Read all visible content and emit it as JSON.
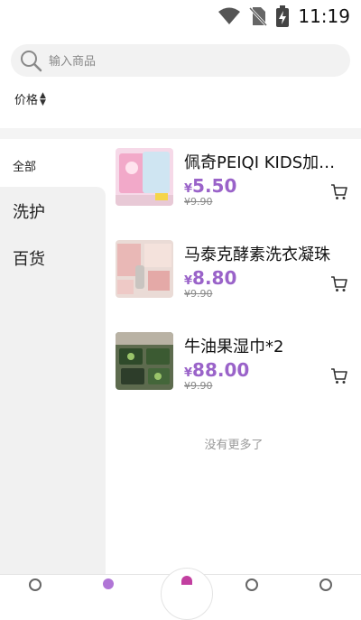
{
  "status_bar": {
    "time": "11:19"
  },
  "search": {
    "placeholder": "输入商品",
    "value": ""
  },
  "sort": {
    "label": "价格",
    "icon": "sort-updown-icon"
  },
  "sidebar": {
    "items": [
      {
        "label": "全部",
        "selected": true
      },
      {
        "label": "洗护",
        "selected": false
      },
      {
        "label": "百货",
        "selected": false
      }
    ]
  },
  "products": [
    {
      "name": "佩奇PEIQI KIDS加厚婴儿手口湿巾",
      "currency": "¥",
      "price": "5.50",
      "original_price": "¥9.90"
    },
    {
      "name": "马泰克酵素洗衣凝珠",
      "currency": "¥",
      "price": "8.80",
      "original_price": "¥9.90"
    },
    {
      "name": "牛油果湿巾*2",
      "currency": "¥",
      "price": "88.00",
      "original_price": "¥9.90"
    }
  ],
  "list_end": "没有更多了",
  "colors": {
    "accent": "#9a63c9",
    "sidebar_bg": "#f1f1f1"
  }
}
